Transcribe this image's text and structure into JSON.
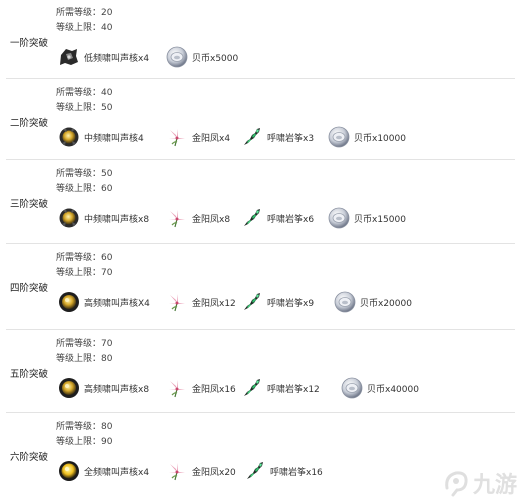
{
  "labels": {
    "req_level_prefix": "所需等级：",
    "cap_level_prefix": "等级上限："
  },
  "stages": [
    {
      "name": "一阶突破",
      "required_level": "20",
      "level_cap": "40",
      "materials": [
        {
          "icon": "core-low-icon",
          "label": "低频啸叫声核x4"
        },
        {
          "icon": "shell-coin-icon",
          "label": "贝币x5000"
        }
      ]
    },
    {
      "name": "二阶突破",
      "required_level": "40",
      "level_cap": "50",
      "materials": [
        {
          "icon": "core-mid-icon",
          "label": "中频啸叫声核4"
        },
        {
          "icon": "flower-icon",
          "label": "金阳凤x4"
        },
        {
          "icon": "crystal-icon",
          "label": "呼啸岩筝x3"
        },
        {
          "icon": "shell-coin-icon",
          "label": "贝币x10000"
        }
      ]
    },
    {
      "name": "三阶突破",
      "required_level": "50",
      "level_cap": "60",
      "materials": [
        {
          "icon": "core-mid-icon",
          "label": "中频啸叫声核x8"
        },
        {
          "icon": "flower-icon",
          "label": "金阳凤x8"
        },
        {
          "icon": "crystal-icon",
          "label": "呼啸岩筝x6"
        },
        {
          "icon": "shell-coin-icon",
          "label": "贝币x15000"
        }
      ]
    },
    {
      "name": "四阶突破",
      "required_level": "60",
      "level_cap": "70",
      "materials": [
        {
          "icon": "core-high-icon",
          "label": "高频啸叫声核X4"
        },
        {
          "icon": "flower-icon",
          "label": "金阳凤x12"
        },
        {
          "icon": "crystal-icon",
          "label": "呼啸岩筝x9"
        },
        {
          "icon": "shell-coin-icon",
          "label": "贝币x20000"
        }
      ]
    },
    {
      "name": "五阶突破",
      "required_level": "70",
      "level_cap": "80",
      "materials": [
        {
          "icon": "core-high-icon",
          "label": "高频啸叫声核x8"
        },
        {
          "icon": "flower-icon",
          "label": "金阳凤x16"
        },
        {
          "icon": "crystal-icon",
          "label": "呼啸岩筝x12"
        },
        {
          "icon": "shell-coin-icon",
          "label": "贝币x40000"
        }
      ]
    },
    {
      "name": "六阶突破",
      "required_level": "80",
      "level_cap": "90",
      "materials": [
        {
          "icon": "core-full-icon",
          "label": "全频啸叫声核x4"
        },
        {
          "icon": "flower-icon",
          "label": "金阳凤x20"
        },
        {
          "icon": "crystal-icon",
          "label": "呼啸岩筝x16"
        }
      ]
    }
  ],
  "watermark": {
    "text": "九游",
    "icon": "ninegame-logo-icon"
  }
}
